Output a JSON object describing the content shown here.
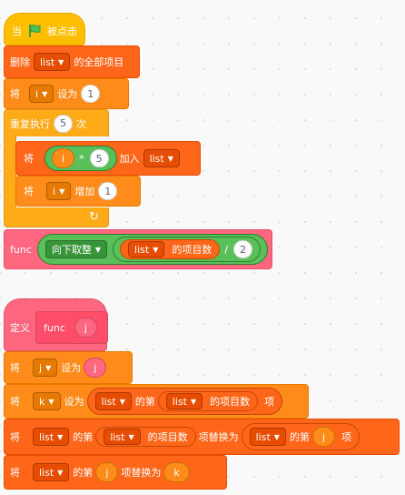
{
  "script1": {
    "hat": {
      "when": "当",
      "clicked": "被点击",
      "flag": "green-flag"
    },
    "delete_all": {
      "label": "删除",
      "list": "list",
      "suffix": "的全部项目"
    },
    "set_i": {
      "prefix": "将",
      "var": "i",
      "to": "设为",
      "value": "1"
    },
    "repeat": {
      "label": "重复执行",
      "count": "5",
      "suffix": "次"
    },
    "add_item": {
      "prefix": "将",
      "var": "i",
      "op": "*",
      "num": "5",
      "add": "加入",
      "list": "list"
    },
    "change_i": {
      "prefix": "将",
      "var": "i",
      "by": "增加",
      "value": "1"
    },
    "call": {
      "name": "func",
      "func": "向下取整",
      "list": "list",
      "length": "的项目数",
      "div": "/",
      "num": "2"
    }
  },
  "script2": {
    "define": {
      "label": "定义",
      "name": "func",
      "param": "j"
    },
    "set_j": {
      "prefix": "将",
      "var": "j",
      "to": "设为",
      "value": "j"
    },
    "set_k": {
      "prefix": "将",
      "var": "k",
      "to": "设为",
      "list": "list",
      "of": "的第",
      "list2": "list",
      "length": "的项目数",
      "item": "项"
    },
    "replace1": {
      "prefix": "将",
      "list": "list",
      "of": "的第",
      "list2": "list",
      "length": "的项目数",
      "replace": "项替换为",
      "list3": "list",
      "of2": "的第",
      "param": "j",
      "item": "项"
    },
    "replace2": {
      "prefix": "将",
      "list": "list",
      "of": "的第",
      "param": "j",
      "replace": "项替换为",
      "value": "k"
    }
  },
  "colors": {
    "event": "#ffbf00",
    "control": "#ffab19",
    "list": "#ff661a",
    "variable": "#ff8c1a",
    "operator": "#59c059",
    "myblocks": "#ff6680"
  }
}
